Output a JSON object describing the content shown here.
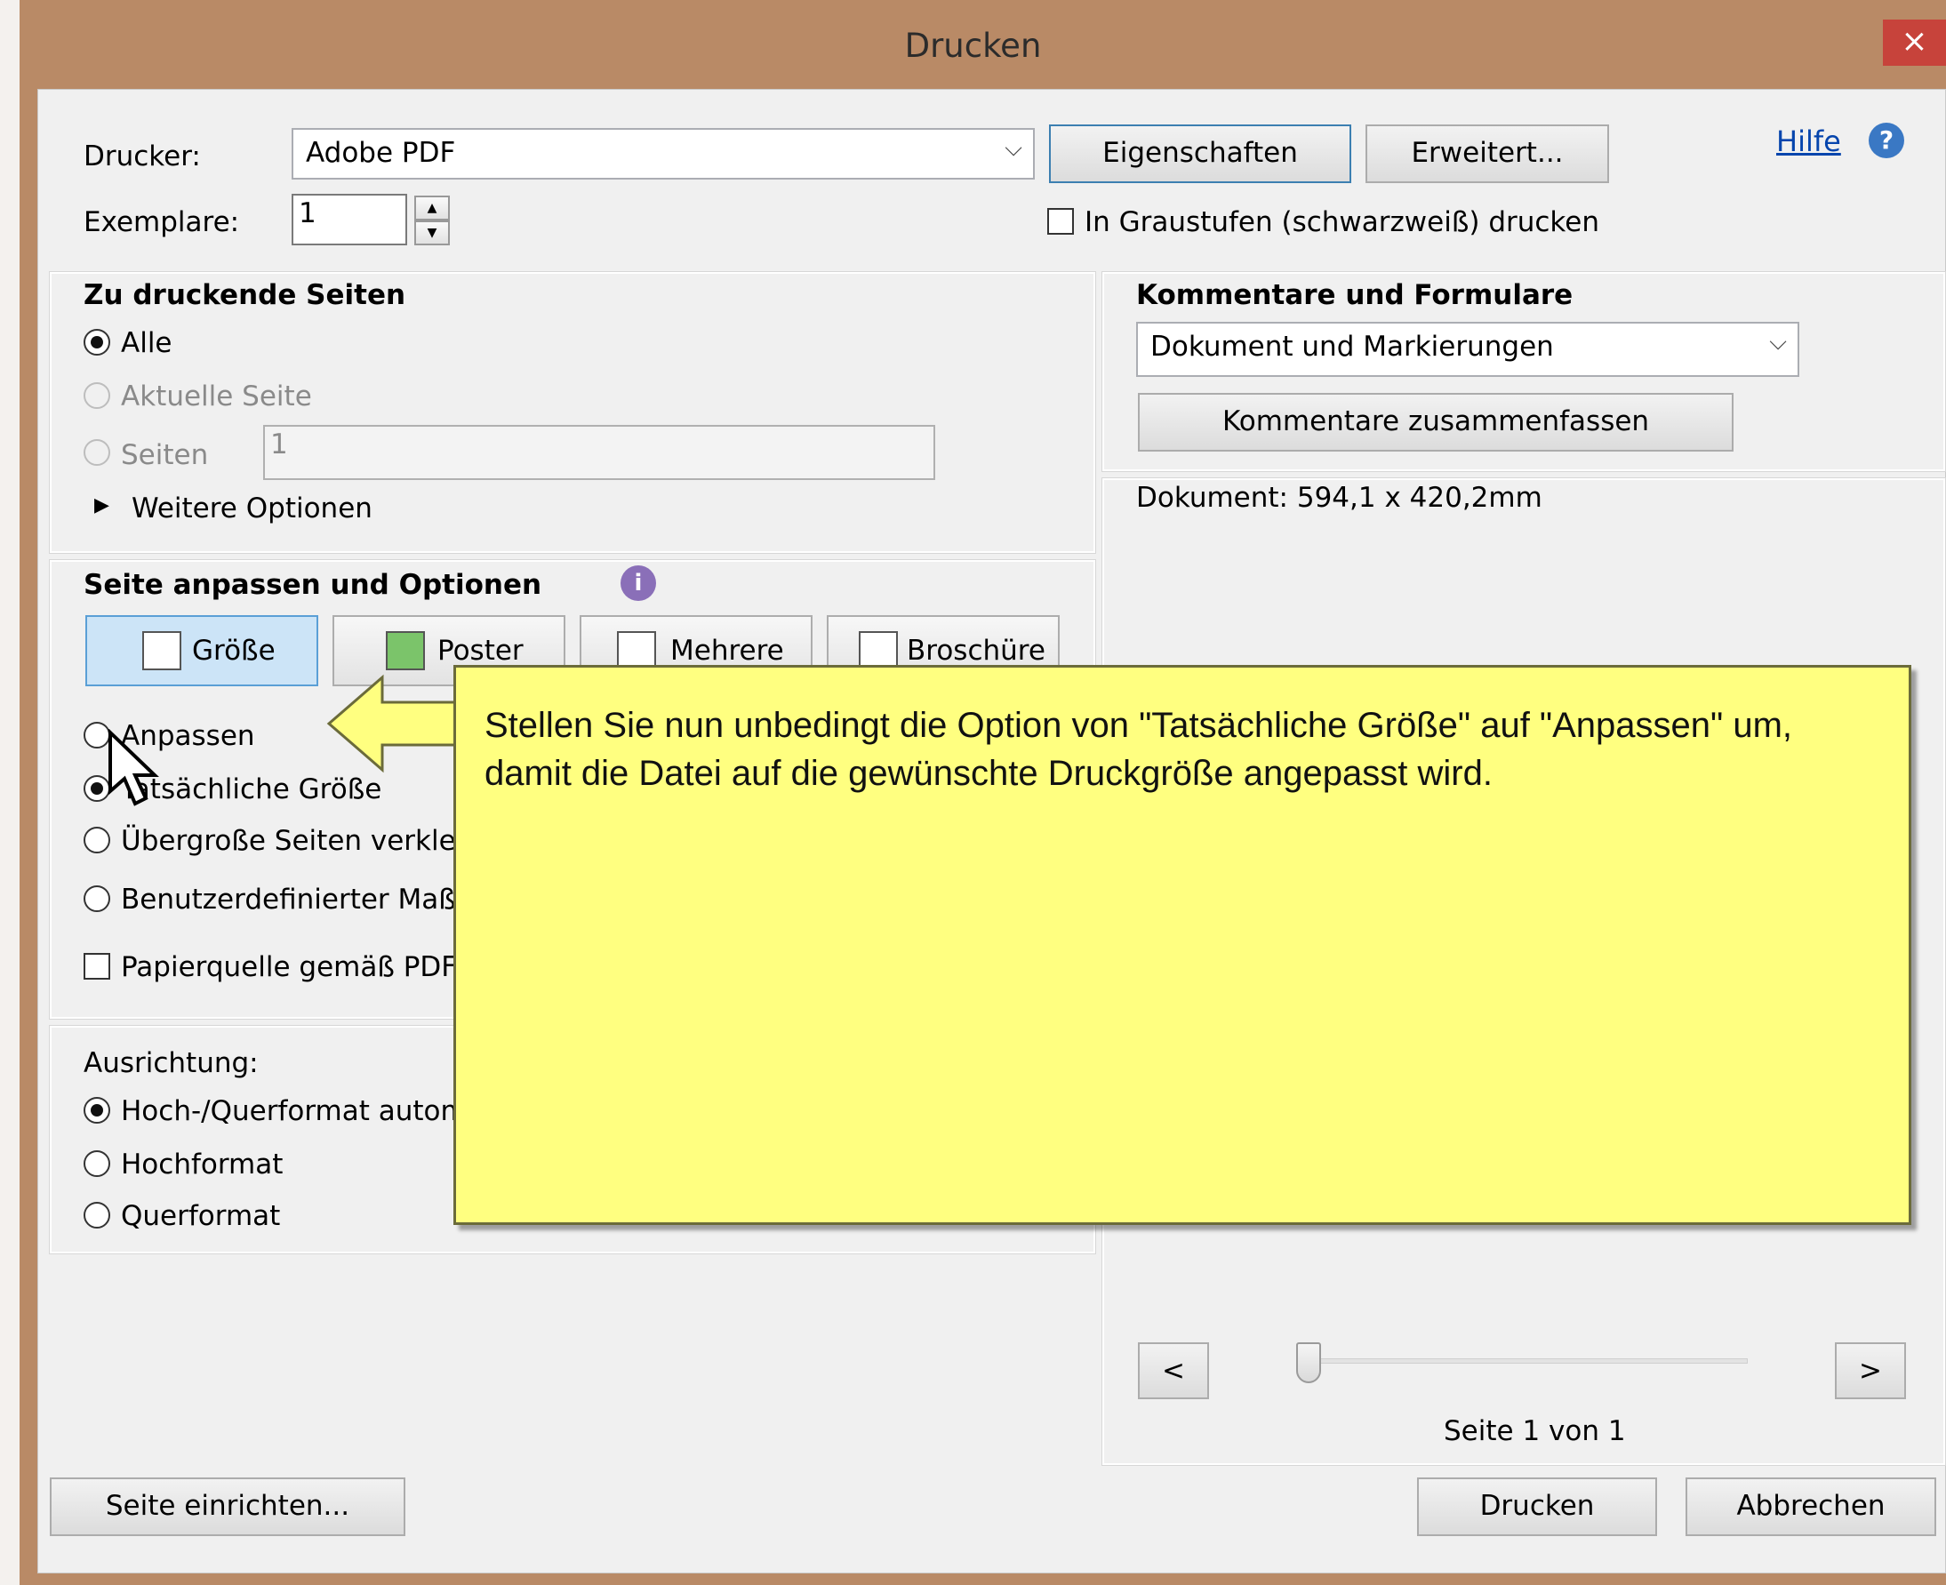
{
  "window": {
    "title": "Drucken",
    "close_glyph": "×"
  },
  "header": {
    "printer_label": "Drucker:",
    "printer_value": "Adobe PDF",
    "copies_label": "Exemplare:",
    "copies_value": "1",
    "properties_button": "Eigenschaften",
    "advanced_button": "Erweitert...",
    "grayscale_label": "In Graustufen (schwarzweiß) drucken",
    "help_link": "Hilfe",
    "help_icon_glyph": "?"
  },
  "pages": {
    "title": "Zu druckende Seiten",
    "all": "Alle",
    "current": "Aktuelle Seite",
    "pages_label": "Seiten",
    "pages_value": "1",
    "more_options": "Weitere Optionen",
    "more_glyph": "▶"
  },
  "comments": {
    "title": "Kommentare und Formulare",
    "select_value": "Dokument und Markierungen",
    "summarize_button": "Kommentare zusammenfassen"
  },
  "fit": {
    "title": "Seite anpassen und Optionen",
    "info_glyph": "i",
    "tabs": {
      "size": "Größe",
      "poster": "Poster",
      "multiple": "Mehrere",
      "booklet": "Broschüre"
    },
    "fit_option": "Anpassen",
    "actual_size": "Tatsächliche Größe",
    "shrink": "Übergroße Seiten verkleine",
    "custom_scale": "Benutzerdefinierter Maßsta",
    "paper_source": "Papierquelle gemäß PDF-S"
  },
  "orientation": {
    "title": "Ausrichtung:",
    "auto": "Hoch-/Querformat autom",
    "portrait": "Hochformat",
    "landscape": "Querformat"
  },
  "preview": {
    "document_size": "Dokument: 594,1 x 420,2mm",
    "prev": "<",
    "next": ">",
    "page_indicator": "Seite 1 von 1"
  },
  "footer": {
    "page_setup": "Seite einrichten...",
    "print": "Drucken",
    "cancel": "Abbrechen"
  },
  "callout": {
    "text": "Stellen Sie nun unbedingt die Option von \"Tatsächliche Größe\" auf \"Anpassen\" um, damit die Datei auf die gewünschte Druckgröße angepasst wird."
  }
}
